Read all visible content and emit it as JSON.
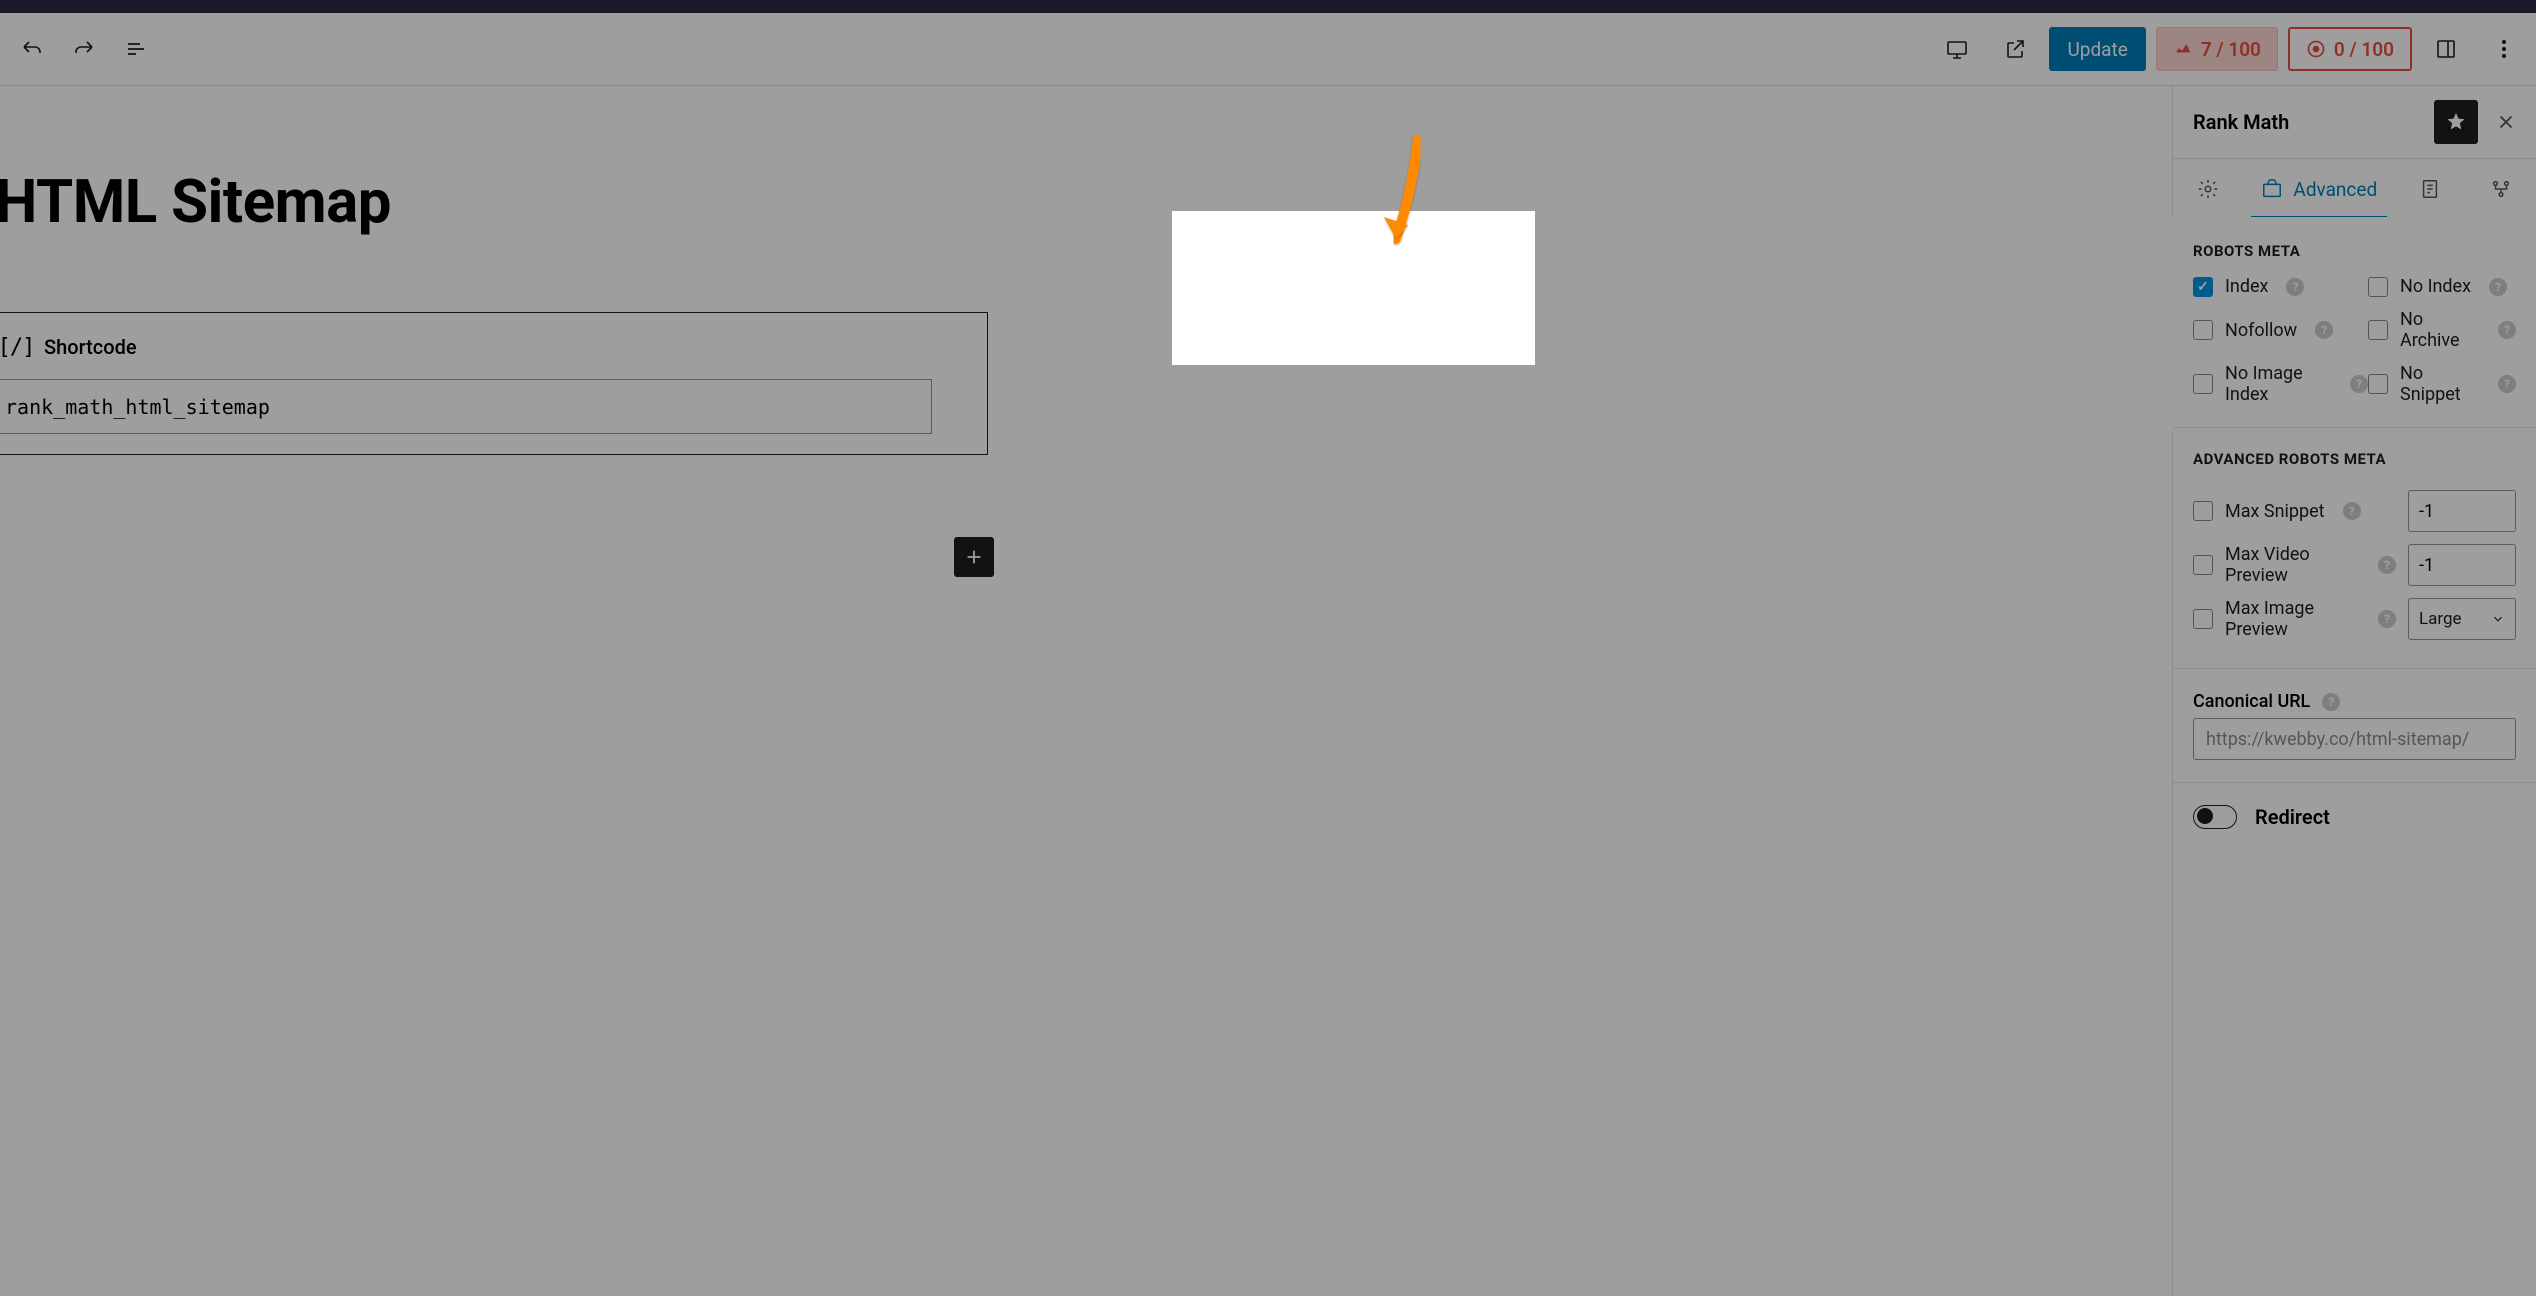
{
  "toolbar": {
    "update_label": "Update",
    "score1": "7 / 100",
    "score2": "0 / 100"
  },
  "editor": {
    "page_title": "HTML Sitemap",
    "block_label": "Shortcode",
    "shortcode_value": "rank_math_html_sitemap"
  },
  "sidebar": {
    "title": "Rank Math",
    "tab_advanced": "Advanced",
    "robots": {
      "heading": "ROBOTS META",
      "index": "Index",
      "nofollow": "Nofollow",
      "no_image_index": "No Image Index",
      "no_index": "No Index",
      "no_archive": "No Archive",
      "no_snippet": "No Snippet"
    },
    "adv": {
      "heading": "ADVANCED ROBOTS META",
      "max_snippet": "Max Snippet",
      "max_video": "Max Video Preview",
      "max_image": "Max Image Preview",
      "val_snippet": "-1",
      "val_video": "-1",
      "val_image": "Large"
    },
    "canonical": {
      "heading": "Canonical URL",
      "placeholder": "https://kwebby.co/html-sitemap/"
    },
    "redirect_label": "Redirect"
  }
}
